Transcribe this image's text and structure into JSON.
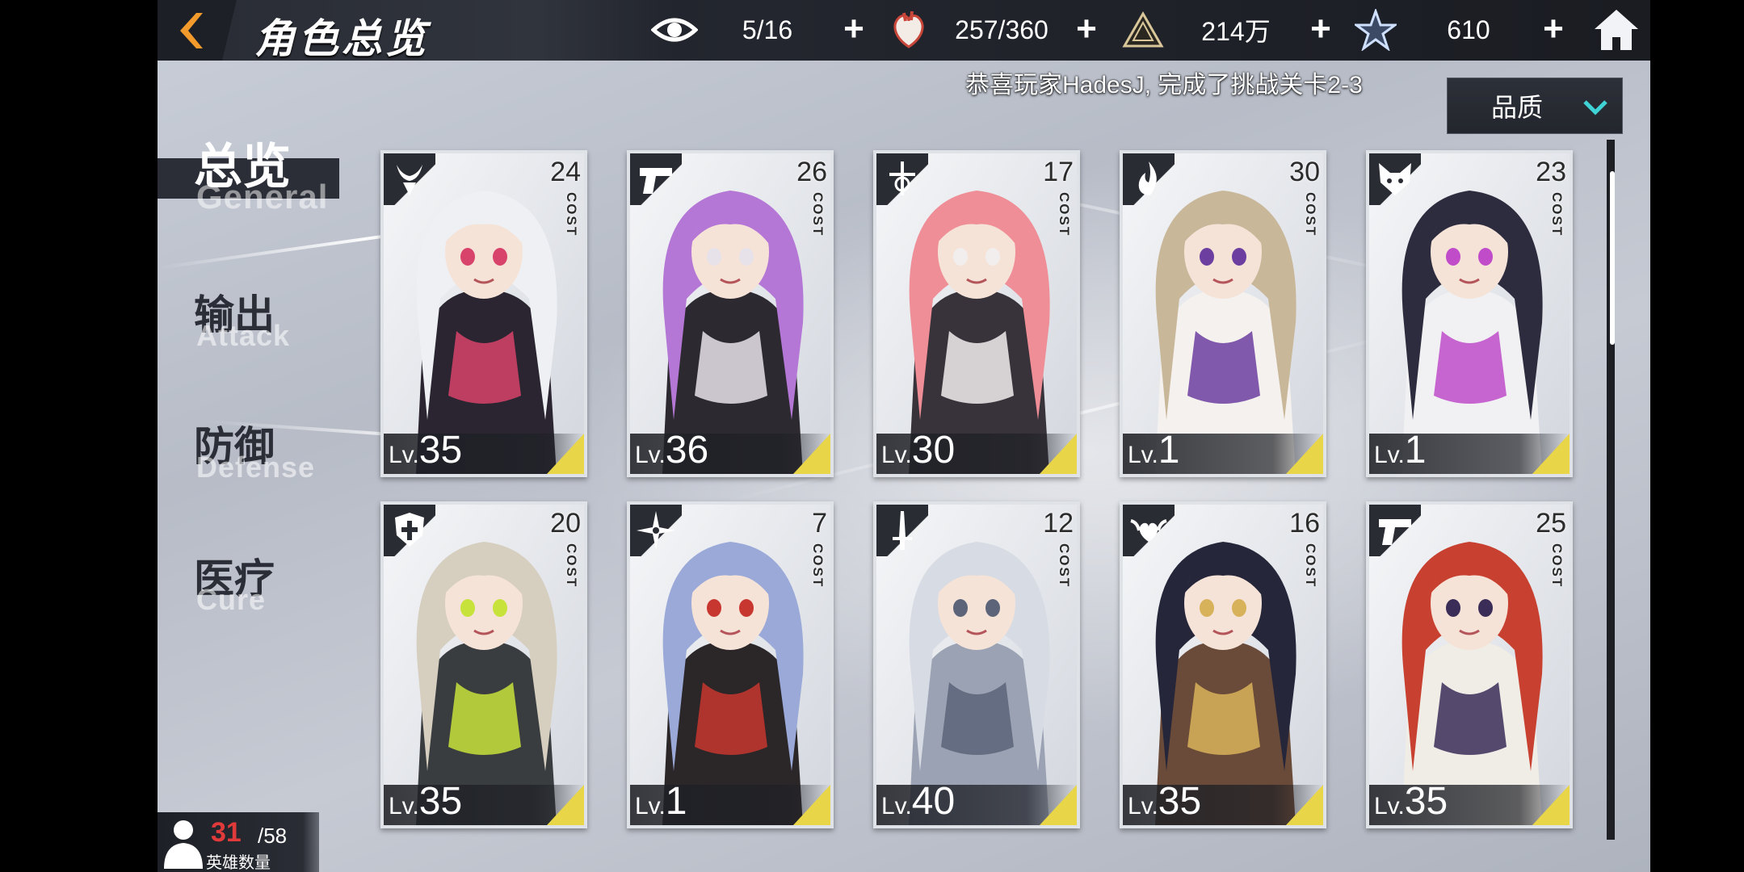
{
  "header": {
    "title": "角色总览",
    "resources": [
      {
        "name": "eye",
        "value": "5/16"
      },
      {
        "name": "stamina",
        "value": "257/360"
      },
      {
        "name": "gold",
        "value": "214万"
      },
      {
        "name": "crystal",
        "value": "610"
      }
    ]
  },
  "notice": "恭喜玩家HadesJ, 完成了挑战关卡2-3",
  "sort": {
    "label": "品质"
  },
  "nav": [
    {
      "cn": "总览",
      "en": "General",
      "active": true
    },
    {
      "cn": "输出",
      "en": "Attack"
    },
    {
      "cn": "防御",
      "en": "Defense"
    },
    {
      "cn": "医疗",
      "en": "Cure"
    }
  ],
  "card_common": {
    "lv_prefix": "Lv.",
    "cost_label": "COST"
  },
  "cards": [
    {
      "cost": "24",
      "level": "35",
      "class_icon": "demon-horn-icon",
      "hair": "#eef0f4",
      "accent": "#d8436b",
      "outfit": "#2a2530"
    },
    {
      "cost": "26",
      "level": "36",
      "class_icon": "pistol-icon",
      "hair": "#b577d6",
      "accent": "#e7e2ea",
      "outfit": "#2c2a30"
    },
    {
      "cost": "17",
      "level": "30",
      "class_icon": "cross-sword-icon",
      "hair": "#ef8e96",
      "accent": "#f2eeee",
      "outfit": "#38333a"
    },
    {
      "cost": "30",
      "level": "1",
      "class_icon": "flame-icon",
      "hair": "#c9b79a",
      "accent": "#6b3ea0",
      "outfit": "#f4f1ee"
    },
    {
      "cost": "23",
      "level": "1",
      "class_icon": "fox-mask-icon",
      "hair": "#2d2c3e",
      "accent": "#c04cc9",
      "outfit": "#f1f1f3"
    },
    {
      "cost": "20",
      "level": "35",
      "class_icon": "shield-cross-icon",
      "hair": "#d6cfc0",
      "accent": "#c7e23a",
      "outfit": "#3a3d40"
    },
    {
      "cost": "7",
      "level": "1",
      "class_icon": "shuriken-icon",
      "hair": "#9aa9d8",
      "accent": "#c8372f",
      "outfit": "#2b2628"
    },
    {
      "cost": "12",
      "level": "40",
      "class_icon": "sword-icon",
      "hair": "#d7dbe3",
      "accent": "#5b6478",
      "outfit": "#9aa2b3"
    },
    {
      "cost": "16",
      "level": "35",
      "class_icon": "heart-wings-icon",
      "hair": "#25263a",
      "accent": "#d8b25a",
      "outfit": "#6a4a38"
    },
    {
      "cost": "25",
      "level": "35",
      "class_icon": "pistol-icon",
      "hair": "#c8402f",
      "accent": "#3a2d58",
      "outfit": "#f0ece6"
    }
  ],
  "hero_count": {
    "current": "31",
    "max": "/58",
    "label": "英雄数量"
  },
  "colors": {
    "topbar": "#1f2229",
    "accent_yellow": "#e9d548",
    "nav_active": "#2b2e37"
  }
}
